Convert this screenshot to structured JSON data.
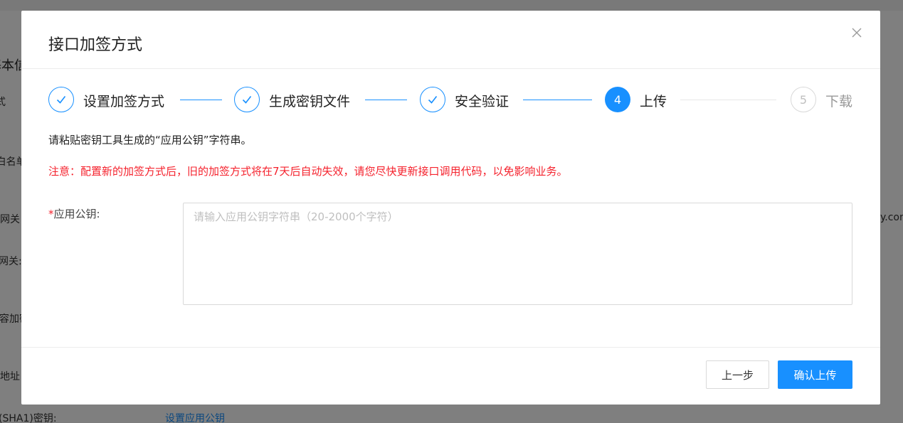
{
  "background": {
    "section_title": "基本信息",
    "row_labels": [
      "加签方式",
      "服务器IP白名单",
      "绑定网关",
      "网关:",
      "内容加密方式",
      "回调地址"
    ],
    "side_text": "y.com",
    "footer_label": "(SHA1)密钥:",
    "footer_link": "设置应用公钥"
  },
  "dialog": {
    "title": "接口加签方式",
    "steps": [
      {
        "index": "1",
        "label": "设置加签方式",
        "status": "done"
      },
      {
        "index": "2",
        "label": "生成密钥文件",
        "status": "done"
      },
      {
        "index": "3",
        "label": "安全验证",
        "status": "done"
      },
      {
        "index": "4",
        "label": "上传",
        "status": "active"
      },
      {
        "index": "5",
        "label": "下载",
        "status": "wait"
      }
    ],
    "hint": "请粘贴密钥工具生成的“应用公钥”字符串。",
    "warning": "注意：配置新的加签方式后，旧的加签方式将在7天后自动失效，请您尽快更新接口调用代码，以免影响业务。",
    "field": {
      "required_mark": "*",
      "label": "应用公钥:",
      "placeholder": "请输入应用公钥字符串（20-2000个字符）",
      "value": ""
    },
    "buttons": {
      "prev": "上一步",
      "confirm": "确认上传"
    }
  },
  "colors": {
    "primary": "#1890ff",
    "error": "#f5222d",
    "overlay": "rgba(0,0,0,0.5)"
  },
  "icons": {
    "close": "close-icon",
    "step_done": "check-icon"
  }
}
